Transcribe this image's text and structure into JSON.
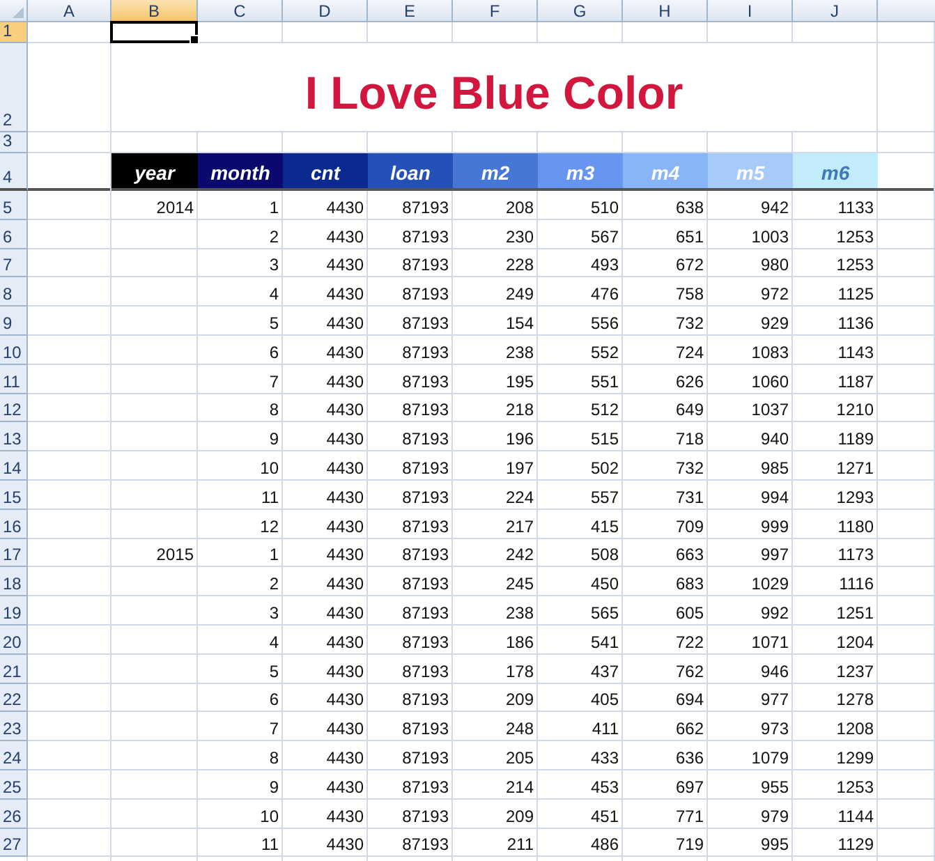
{
  "column_headers": [
    {
      "label": "A",
      "selected": false
    },
    {
      "label": "B",
      "selected": true
    },
    {
      "label": "C",
      "selected": false
    },
    {
      "label": "D",
      "selected": false
    },
    {
      "label": "E",
      "selected": false
    },
    {
      "label": "F",
      "selected": false
    },
    {
      "label": "G",
      "selected": false
    },
    {
      "label": "H",
      "selected": false
    },
    {
      "label": "I",
      "selected": false
    },
    {
      "label": "J",
      "selected": false
    }
  ],
  "row_headers": [
    {
      "label": "1",
      "selected": true
    },
    {
      "label": "2",
      "selected": false
    },
    {
      "label": "3",
      "selected": false
    },
    {
      "label": "4",
      "selected": false
    },
    {
      "label": "5",
      "selected": false
    },
    {
      "label": "6",
      "selected": false
    },
    {
      "label": "7",
      "selected": false
    },
    {
      "label": "8",
      "selected": false
    },
    {
      "label": "9",
      "selected": false
    },
    {
      "label": "10",
      "selected": false
    },
    {
      "label": "11",
      "selected": false
    },
    {
      "label": "12",
      "selected": false
    },
    {
      "label": "13",
      "selected": false
    },
    {
      "label": "14",
      "selected": false
    },
    {
      "label": "15",
      "selected": false
    },
    {
      "label": "16",
      "selected": false
    },
    {
      "label": "17",
      "selected": false
    },
    {
      "label": "18",
      "selected": false
    },
    {
      "label": "19",
      "selected": false
    },
    {
      "label": "20",
      "selected": false
    },
    {
      "label": "21",
      "selected": false
    },
    {
      "label": "22",
      "selected": false
    },
    {
      "label": "23",
      "selected": false
    },
    {
      "label": "24",
      "selected": false
    },
    {
      "label": "25",
      "selected": false
    },
    {
      "label": "26",
      "selected": false
    },
    {
      "label": "27",
      "selected": false
    }
  ],
  "title": "I Love Blue Color",
  "table": {
    "columns": [
      {
        "label": "year",
        "color": "#000000"
      },
      {
        "label": "month",
        "color": "#0a0a6e"
      },
      {
        "label": "cnt",
        "color": "#0a2a92"
      },
      {
        "label": "loan",
        "color": "#2450b8"
      },
      {
        "label": "m2",
        "color": "#4676d6"
      },
      {
        "label": "m3",
        "color": "#6895f0"
      },
      {
        "label": "m4",
        "color": "#88b4f8"
      },
      {
        "label": "m5",
        "color": "#a6cbf8"
      },
      {
        "label": "m6",
        "color": "#c2ecfa"
      }
    ],
    "rows": [
      {
        "year": "2014",
        "values": [
          "1",
          "4430",
          "87193",
          "208",
          "510",
          "638",
          "942",
          "1133"
        ]
      },
      {
        "values": [
          "2",
          "4430",
          "87193",
          "230",
          "567",
          "651",
          "1003",
          "1253"
        ]
      },
      {
        "values": [
          "3",
          "4430",
          "87193",
          "228",
          "493",
          "672",
          "980",
          "1253"
        ]
      },
      {
        "values": [
          "4",
          "4430",
          "87193",
          "249",
          "476",
          "758",
          "972",
          "1125"
        ]
      },
      {
        "values": [
          "5",
          "4430",
          "87193",
          "154",
          "556",
          "732",
          "929",
          "1136"
        ]
      },
      {
        "values": [
          "6",
          "4430",
          "87193",
          "238",
          "552",
          "724",
          "1083",
          "1143"
        ]
      },
      {
        "values": [
          "7",
          "4430",
          "87193",
          "195",
          "551",
          "626",
          "1060",
          "1187"
        ]
      },
      {
        "values": [
          "8",
          "4430",
          "87193",
          "218",
          "512",
          "649",
          "1037",
          "1210"
        ]
      },
      {
        "values": [
          "9",
          "4430",
          "87193",
          "196",
          "515",
          "718",
          "940",
          "1189"
        ]
      },
      {
        "values": [
          "10",
          "4430",
          "87193",
          "197",
          "502",
          "732",
          "985",
          "1271"
        ]
      },
      {
        "values": [
          "11",
          "4430",
          "87193",
          "224",
          "557",
          "731",
          "994",
          "1293"
        ]
      },
      {
        "values": [
          "12",
          "4430",
          "87193",
          "217",
          "415",
          "709",
          "999",
          "1180"
        ]
      },
      {
        "year": "2015",
        "values": [
          "1",
          "4430",
          "87193",
          "242",
          "508",
          "663",
          "997",
          "1173"
        ]
      },
      {
        "values": [
          "2",
          "4430",
          "87193",
          "245",
          "450",
          "683",
          "1029",
          "1116"
        ]
      },
      {
        "values": [
          "3",
          "4430",
          "87193",
          "238",
          "565",
          "605",
          "992",
          "1251"
        ]
      },
      {
        "values": [
          "4",
          "4430",
          "87193",
          "186",
          "541",
          "722",
          "1071",
          "1204"
        ]
      },
      {
        "values": [
          "5",
          "4430",
          "87193",
          "178",
          "437",
          "762",
          "946",
          "1237"
        ]
      },
      {
        "values": [
          "6",
          "4430",
          "87193",
          "209",
          "405",
          "694",
          "977",
          "1278"
        ]
      },
      {
        "values": [
          "7",
          "4430",
          "87193",
          "248",
          "411",
          "662",
          "973",
          "1208"
        ]
      },
      {
        "values": [
          "8",
          "4430",
          "87193",
          "205",
          "433",
          "636",
          "1079",
          "1299"
        ]
      },
      {
        "values": [
          "9",
          "4430",
          "87193",
          "214",
          "453",
          "697",
          "955",
          "1253"
        ]
      },
      {
        "values": [
          "10",
          "4430",
          "87193",
          "209",
          "451",
          "771",
          "979",
          "1144"
        ]
      },
      {
        "values": [
          "11",
          "4430",
          "87193",
          "211",
          "486",
          "719",
          "995",
          "1129"
        ]
      }
    ]
  }
}
